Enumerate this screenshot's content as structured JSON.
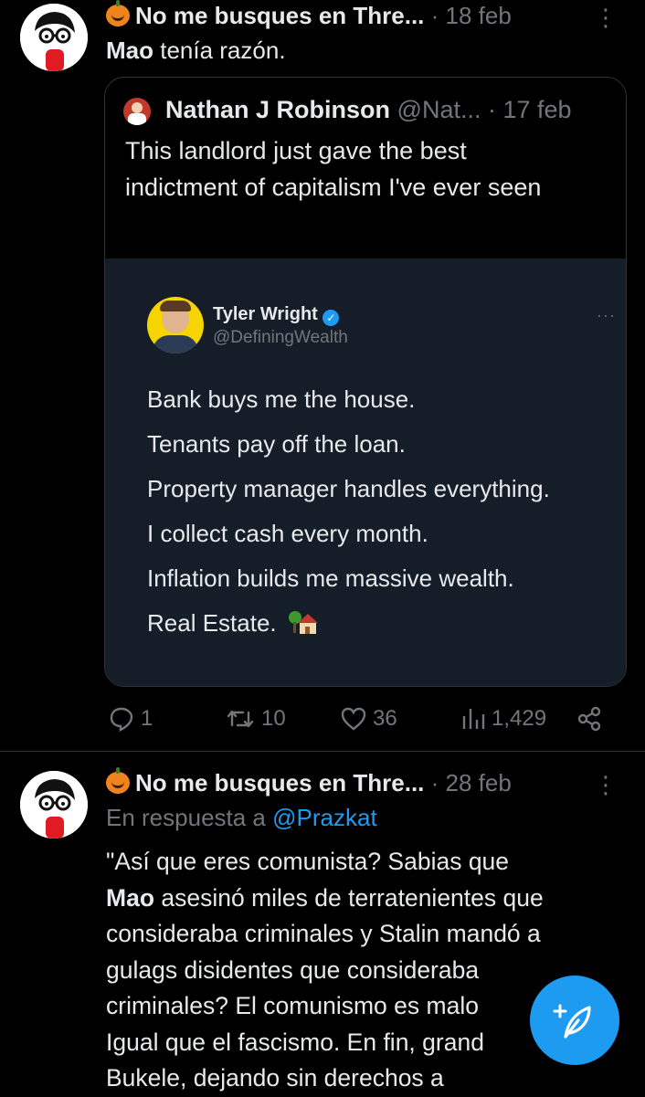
{
  "post1": {
    "author_name": "No me busques en Thre...",
    "date": "· 18 feb",
    "text_bold": "Mao",
    "text_rest": " tenía razón.",
    "more_icon": "more-vertical-icon",
    "quoted": {
      "author_name": "Nathan J Robinson",
      "handle": "@Nat...",
      "date": "· 17 feb",
      "text": "This landlord just gave the best indictment of capitalism I've ever seen",
      "embedded_tweet": {
        "name": "Tyler Wright",
        "handle": "@DefiningWealth",
        "lines": [
          "Bank buys me the house.",
          "Tenants pay off the loan.",
          "Property manager handles everything.",
          "I collect cash every month.",
          "Inflation builds me massive wealth.",
          "Real Estate."
        ],
        "verified_color": "#1d9bf0",
        "avatar_bg": "#f5d400"
      }
    },
    "actions": {
      "replies": "1",
      "reposts": "10",
      "likes": "36",
      "views": "1,429"
    }
  },
  "post2": {
    "author_name": "No me busques en Thre...",
    "date": "· 28 feb",
    "reply_prefix": "En respuesta a ",
    "reply_handle": "@Prazkat",
    "text_line1": "\"Así que eres comunista? Sabias que",
    "text_bold": "Mao",
    "text_line2_rest": " asesinó miles de terratenientes que",
    "text_line3": "consideraba criminales y Stalin mandó a",
    "text_line4": "gulags disidentes que consideraba",
    "text_line5": "criminales? El comunismo es malo",
    "text_line6": "Igual que el fascismo. En fin, grand",
    "text_line7": "Bukele, dejando sin derechos a"
  },
  "fab": {
    "icon": "compose-plus-feather-icon",
    "color": "#1d9bf0"
  },
  "colors": {
    "link": "#1d9bf0",
    "muted": "#71767b",
    "background": "#000000"
  }
}
